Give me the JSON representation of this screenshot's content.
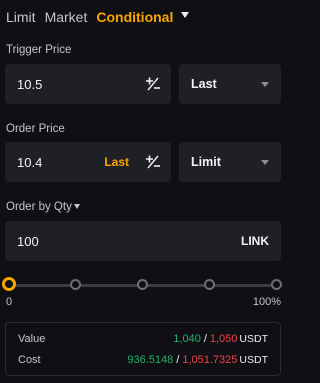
{
  "tabs": {
    "limit": "Limit",
    "market": "Market",
    "conditional": "Conditional"
  },
  "trigger_price": {
    "label": "Trigger Price",
    "value": "10.5",
    "trigger_type": "Last"
  },
  "order_price": {
    "label": "Order Price",
    "value": "10.4",
    "inline_tag": "Last",
    "order_type": "Limit"
  },
  "order_qty": {
    "label": "Order by Qty",
    "value": "100",
    "unit": "LINK"
  },
  "slider": {
    "min_label": "0",
    "max_label": "100%",
    "value_percent": 0
  },
  "summary": {
    "value_label": "Value",
    "value_buy": "1,040",
    "value_sell": "1,050",
    "value_unit": "USDT",
    "cost_label": "Cost",
    "cost_buy": "936.5148",
    "cost_sell": "1,051.7325",
    "cost_unit": "USDT"
  },
  "colors": {
    "accent": "#f7a600",
    "buy": "#20b26c",
    "sell": "#ef454a",
    "background": "#101014",
    "field": "#1e2026"
  },
  "icons": {
    "caret": "chevron-down-icon",
    "plus_minus": "plus-minus-icon"
  }
}
